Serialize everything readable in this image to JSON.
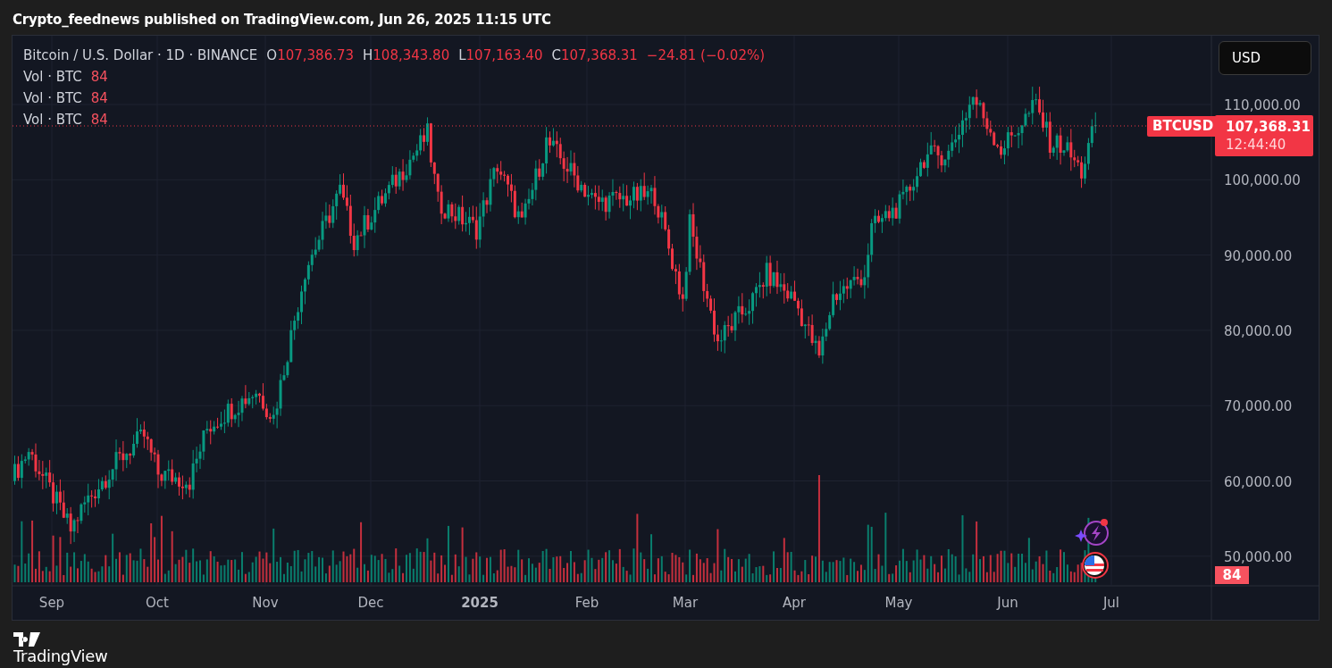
{
  "header": {
    "published": "Crypto_feednews published on TradingView.com, Jun 26, 2025 11:15 UTC"
  },
  "legend": {
    "symbol": "Bitcoin / U.S. Dollar · 1D · BINANCE",
    "ohlc": [
      {
        "label": "O",
        "value": "107,386.73"
      },
      {
        "label": "H",
        "value": "108,343.80"
      },
      {
        "label": "L",
        "value": "107,163.40"
      },
      {
        "label": "C",
        "value": "107,368.31"
      }
    ],
    "change": "−24.81 (−0.02%)",
    "indicators": [
      {
        "label": "Vol · BTC",
        "value": "84"
      },
      {
        "label": "Vol · BTC",
        "value": "84"
      },
      {
        "label": "Vol · BTC",
        "value": "84"
      }
    ]
  },
  "currency_button": "USD",
  "price_axis": [
    "110,000.00",
    "100,000.00",
    "90,000.00",
    "80,000.00",
    "70,000.00",
    "60,000.00",
    "50,000.00"
  ],
  "price_tag": {
    "symbol": "BTCUSD",
    "price": "107,368.31",
    "countdown": "12:44:40"
  },
  "volume_tag": "84",
  "time_axis": [
    {
      "label": "Sep",
      "kind": "month"
    },
    {
      "label": "Oct",
      "kind": "month"
    },
    {
      "label": "Nov",
      "kind": "month"
    },
    {
      "label": "Dec",
      "kind": "month"
    },
    {
      "label": "2025",
      "kind": "year"
    },
    {
      "label": "Feb",
      "kind": "month"
    },
    {
      "label": "Mar",
      "kind": "month"
    },
    {
      "label": "Apr",
      "kind": "month"
    },
    {
      "label": "May",
      "kind": "month"
    },
    {
      "label": "Jun",
      "kind": "month"
    },
    {
      "label": "Jul",
      "kind": "month"
    }
  ],
  "footer": {
    "logo": "TradingView"
  }
}
